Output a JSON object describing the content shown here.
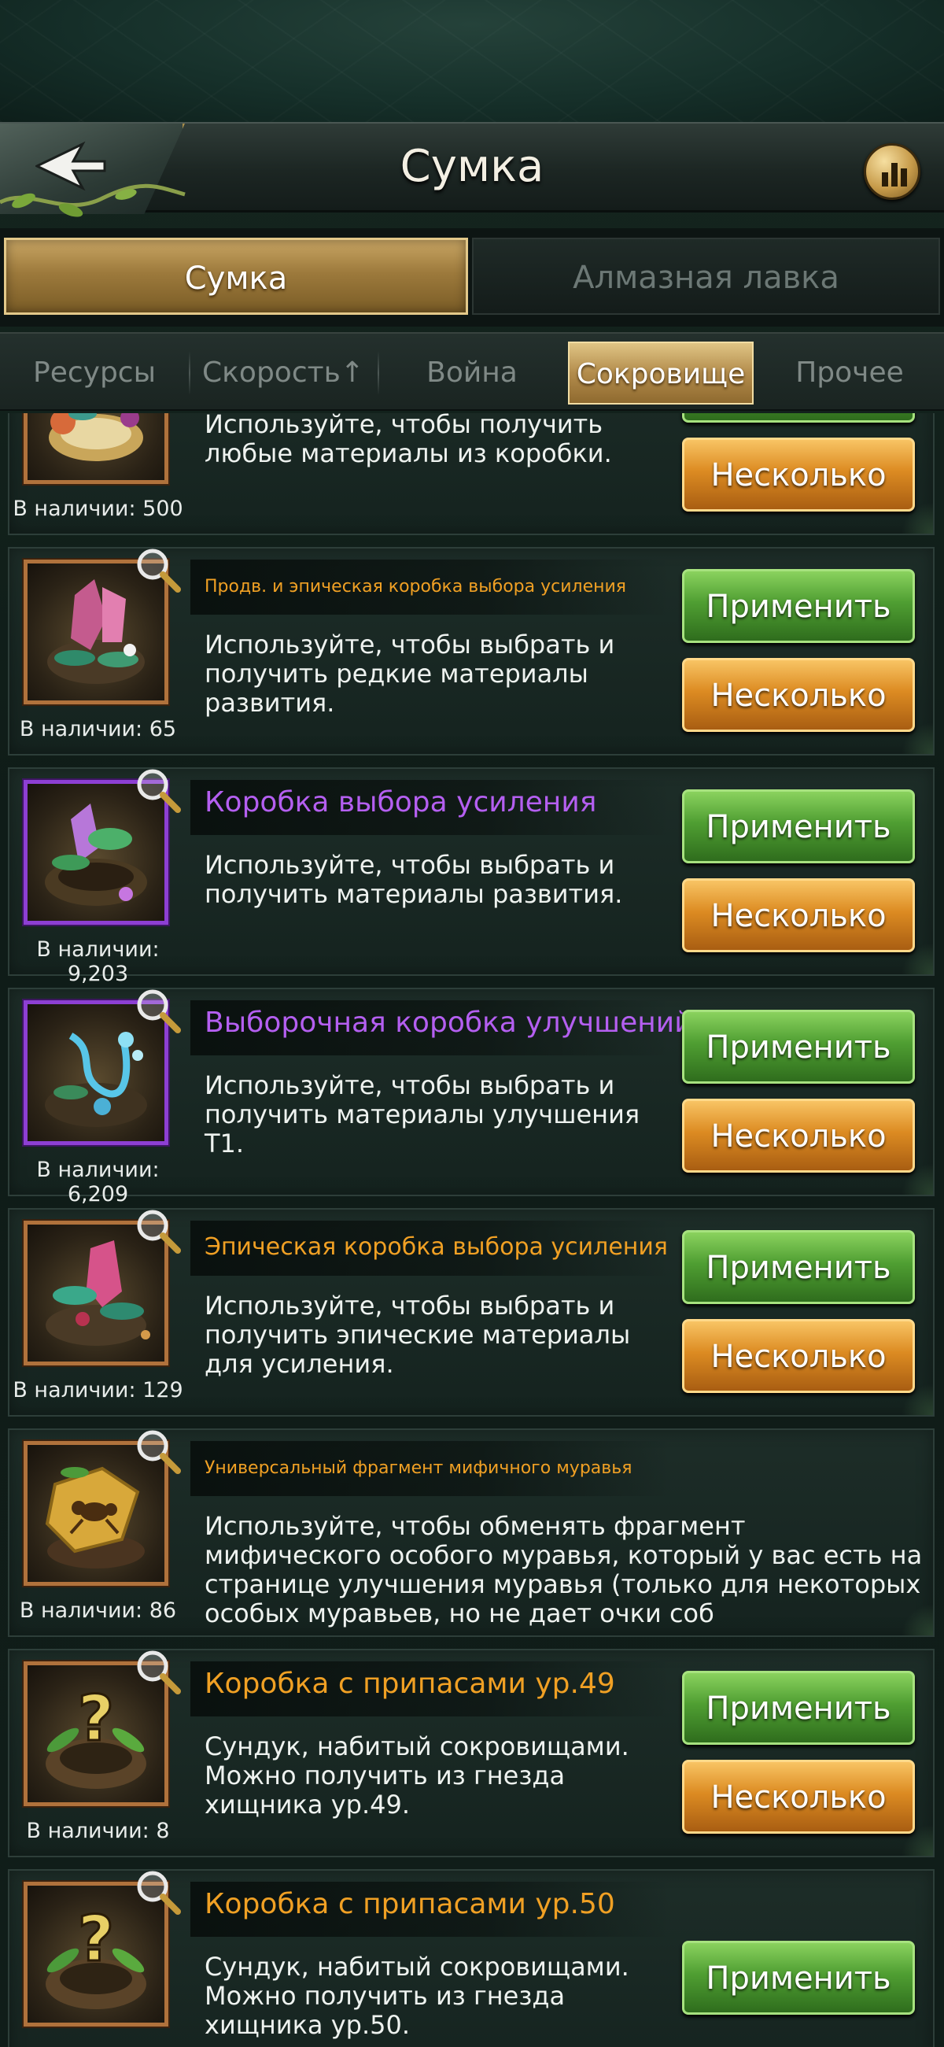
{
  "header": {
    "title": "Сумка"
  },
  "main_tabs": [
    {
      "label": "Сумка",
      "active": true
    },
    {
      "label": "Алмазная лавка",
      "active": false
    }
  ],
  "sub_tabs": [
    {
      "label": "Ресурсы",
      "active": false
    },
    {
      "label": "Скорость↑",
      "active": false
    },
    {
      "label": "Война",
      "active": false
    },
    {
      "label": "Сокровище",
      "active": true
    },
    {
      "label": "Прочее",
      "active": false
    }
  ],
  "buttons": {
    "apply": "Применить",
    "multiple": "Несколько"
  },
  "items": [
    {
      "name": "",
      "description": "Используйте, чтобы получить любые материалы из коробки.",
      "count": "В наличии: 500",
      "icon": "mushroom-egg-box-icon"
    },
    {
      "name": "Продв. и эпическая коробка выбора усиления",
      "description": "Используйте, чтобы выбрать и получить редкие материалы развития.",
      "count": "В наличии: 65",
      "icon": "crystal-egg-box-icon",
      "name_color": "#f0a024"
    },
    {
      "name": "Коробка выбора усиления",
      "description": "Используйте, чтобы выбрать и получить материалы развития.",
      "count": "В наличии: 9,203",
      "icon": "nest-box-icon",
      "name_color": "#b45ff0"
    },
    {
      "name": "Выборочная коробка улучшений",
      "description": "Используйте, чтобы выбрать и получить материалы улучшения T1.",
      "count": "В наличии: 6,209",
      "icon": "dna-nest-box-icon",
      "name_color": "#b45ff0"
    },
    {
      "name": "Эпическая коробка выбора усиления",
      "description": "Используйте, чтобы выбрать и получить эпические материалы для усиления.",
      "count": "В наличии: 129",
      "icon": "epic-crystal-box-icon",
      "name_color": "#f0a024"
    },
    {
      "name": "Универсальный фрагмент мифичного муравья",
      "description": "Используйте, чтобы обменять фрагмент мифического особого муравья, который у вас есть на странице улучшения муравья (только для некоторых особых муравьев, но не дает очки соб",
      "count": "В наличии: 86",
      "icon": "ant-puzzle-fragment-icon",
      "name_color": "#f0a024"
    },
    {
      "name": "Коробка с припасами ур.49",
      "description": "Сундук, набитый сокровищами. Можно получить из гнезда хищника ур.49.",
      "count": "В наличии: 8",
      "icon": "question-nest-icon",
      "name_color": "#f0a024"
    },
    {
      "name": "Коробка с припасами ур.50",
      "description": "Сундук, набитый сокровищами. Можно получить из гнезда хищника ур.50.",
      "count": "",
      "icon": "question-nest-icon",
      "name_color": "#f0a024"
    }
  ]
}
